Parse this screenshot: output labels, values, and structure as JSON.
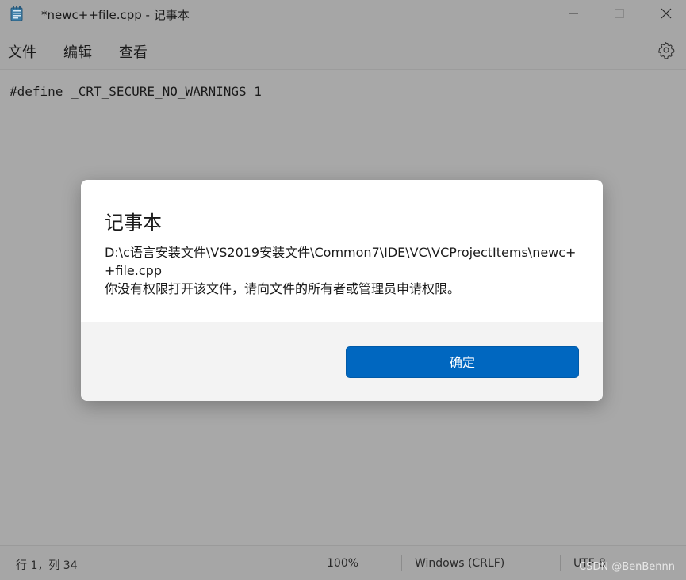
{
  "window": {
    "title": "*newc++file.cpp - 记事本",
    "icon": "notepad-icon"
  },
  "menu": {
    "items": [
      "文件",
      "编辑",
      "查看"
    ],
    "settings_icon": "gear-icon"
  },
  "editor": {
    "content": "#define _CRT_SECURE_NO_WARNINGS 1"
  },
  "status": {
    "position": "行 1，列 34",
    "zoom": "100%",
    "line_ending": "Windows (CRLF)",
    "encoding": "UTF-8"
  },
  "dialog": {
    "title": "记事本",
    "path_line1": "D:\\c语言安装文件\\VS2019安装文件\\Common7\\IDE\\VC\\VCProjectItems\\newc+",
    "path_line2": "+file.cpp",
    "message": "你没有权限打开该文件，请向文件的所有者或管理员申请权限。",
    "ok_label": "确定"
  },
  "watermark": "CSDN @BenBennn",
  "colors": {
    "accent": "#0067c0",
    "overlay": "#a9a9a9"
  }
}
